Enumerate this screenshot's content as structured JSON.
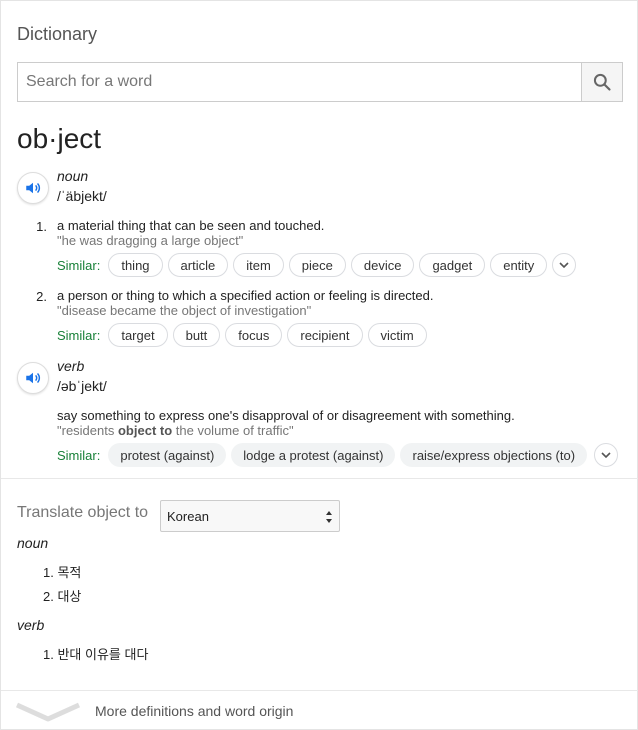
{
  "widget": {
    "title": "Dictionary",
    "search_placeholder": "Search for a word",
    "search_icon": "search-icon"
  },
  "entry": {
    "headword": "ob·ject",
    "noun": {
      "pos": "noun",
      "phonetic": "/ˈäbjekt/",
      "senses": [
        {
          "num": "1.",
          "definition": "a material thing that can be seen and touched.",
          "example": "\"he was dragging a large object\"",
          "similar_label": "Similar:",
          "similar": [
            "thing",
            "article",
            "item",
            "piece",
            "device",
            "gadget",
            "entity"
          ]
        },
        {
          "num": "2.",
          "definition": "a person or thing to which a specified action or feeling is directed.",
          "example": "\"disease became the object of investigation\"",
          "similar_label": "Similar:",
          "similar": [
            "target",
            "butt",
            "focus",
            "recipient",
            "victim"
          ]
        }
      ]
    },
    "verb": {
      "pos": "verb",
      "phonetic": "/əbˈjekt/",
      "senses": [
        {
          "definition": "say something to express one's disapproval of or disagreement with something.",
          "example_pre": "\"residents ",
          "example_bold": "object to",
          "example_post": " the volume of traffic\"",
          "similar_label": "Similar:",
          "similar": [
            "protest (against)",
            "lodge a protest (against)",
            "raise/express objections (to)"
          ]
        }
      ]
    }
  },
  "translate": {
    "label": "Translate object to",
    "language": "Korean",
    "noun_pos": "noun",
    "noun_items": [
      {
        "num": "1.",
        "text": "목적"
      },
      {
        "num": "2.",
        "text": "대상"
      }
    ],
    "verb_pos": "verb",
    "verb_items": [
      {
        "num": "1.",
        "text": "반대 이유를 대다"
      }
    ]
  },
  "footer": {
    "more_label": "More definitions and word origin"
  },
  "colors": {
    "similar_label": "#188038",
    "example_text": "#767676",
    "audio_icon": "#1a73e8"
  }
}
